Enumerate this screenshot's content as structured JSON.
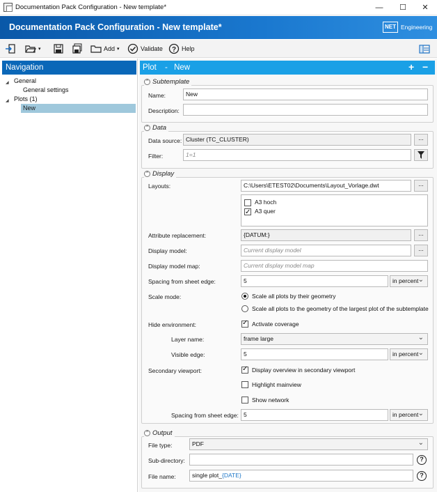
{
  "window": {
    "title": "Documentation Pack Configuration - New template*",
    "minimize": "—",
    "maximize": "☐",
    "close": "✕"
  },
  "banner": {
    "title": "Documentation Pack Configuration - New template*",
    "logo_mark": "NET",
    "logo_text": "Engineering"
  },
  "toolbar": {
    "add_label": "Add",
    "validate_label": "Validate",
    "help_label": "Help",
    "icons": [
      "import-icon",
      "open-folder-icon",
      "save-icon",
      "save-all-icon",
      "add-icon",
      "validate-icon",
      "help-icon",
      "layout-icon"
    ]
  },
  "nav": {
    "title": "Navigation",
    "general": "General",
    "general_settings": "General settings",
    "plots": "Plots (1)",
    "plot_new": "New"
  },
  "main": {
    "title_left": "Plot",
    "title_sep": "-",
    "title_right": "New",
    "plus": "+",
    "minus": "−"
  },
  "subtemplate": {
    "title": "Subtemplate",
    "name_label": "Name:",
    "name_value": "New",
    "desc_label": "Description:",
    "desc_value": ""
  },
  "data": {
    "title": "Data",
    "source_label": "Data source:",
    "source_value": "Cluster (TC_CLUSTER)",
    "filter_label": "Filter:",
    "filter_placeholder": "1=1"
  },
  "display": {
    "title": "Display",
    "layouts_label": "Layouts:",
    "layouts_value": "C:\\Users\\ETEST02\\Documents\\Layout_Vorlage.dwt",
    "layout_items": [
      {
        "label": "A3 hoch",
        "checked": false
      },
      {
        "label": "A3 quer",
        "checked": true
      }
    ],
    "attr_label": "Attribute replacement:",
    "attr_value": "{DATUM:}",
    "model_label": "Display model:",
    "model_placeholder": "Current display model",
    "modelmap_label": "Display model map:",
    "modelmap_placeholder": "Current display model map",
    "spacing_label": "Spacing from sheet edge:",
    "spacing_value": "5",
    "spacing_unit": "in percent",
    "scale_label": "Scale mode:",
    "scale_opt1": "Scale all plots by their geometry",
    "scale_opt2": "Scale all plots to the geometry of the largest plot of the subtemplate",
    "hide_label": "Hide environment:",
    "hide_check": "Activate coverage",
    "layer_label": "Layer name:",
    "layer_value": "frame large",
    "visible_label": "Visible edge:",
    "visible_value": "5",
    "visible_unit": "in percent",
    "secondary_label": "Secondary viewport:",
    "secondary_opt1": "Display overview in secondary viewport",
    "secondary_opt2": "Highlight mainview",
    "secondary_opt3": "Show network",
    "spacing2_label": "Spacing from sheet edge:",
    "spacing2_value": "5",
    "spacing2_unit": "in percent"
  },
  "output": {
    "title": "Output",
    "filetype_label": "File type:",
    "filetype_value": "PDF",
    "subdir_label": "Sub-directory:",
    "subdir_value": "",
    "filename_label": "File name:",
    "filename_prefix": "single plot_",
    "filename_token": "{DATE}"
  },
  "colors": {
    "banner": "#0a58a8",
    "nav_head": "#0a67b8",
    "main_head": "#1aa0e6",
    "selection": "#9fc8dc",
    "token": "#1f78c8"
  }
}
